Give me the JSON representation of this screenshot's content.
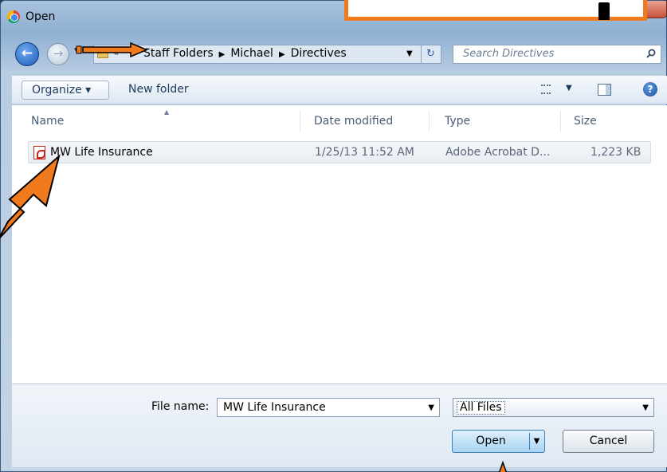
{
  "window": {
    "title": "Open",
    "icon": "chrome-icon"
  },
  "nav": {
    "back_icon": "back-arrow-icon",
    "forward_icon": "forward-arrow-icon",
    "breadcrumb": [
      "Staff Folders",
      "Michael",
      "Directives"
    ],
    "breadcrumb_prefix": "«",
    "search_placeholder": "Search Directives"
  },
  "toolbar": {
    "organize_label": "Organize ▾",
    "new_folder_label": "New folder"
  },
  "columns": {
    "name": "Name",
    "date": "Date modified",
    "type": "Type",
    "size": "Size"
  },
  "files": [
    {
      "name": "MW Life Insurance",
      "date": "1/25/13 11:52 AM",
      "type": "Adobe Acrobat D...",
      "size": "1,223 KB",
      "icon": "pdf-icon"
    }
  ],
  "footer": {
    "file_name_label": "File name:",
    "file_name_value": "MW Life Insurance",
    "filter_value": "All Files",
    "open_label": "Open",
    "cancel_label": "Cancel"
  },
  "annotations": {
    "arrow_color": "#f07a1c",
    "callout_border_color": "#f07a1c"
  }
}
